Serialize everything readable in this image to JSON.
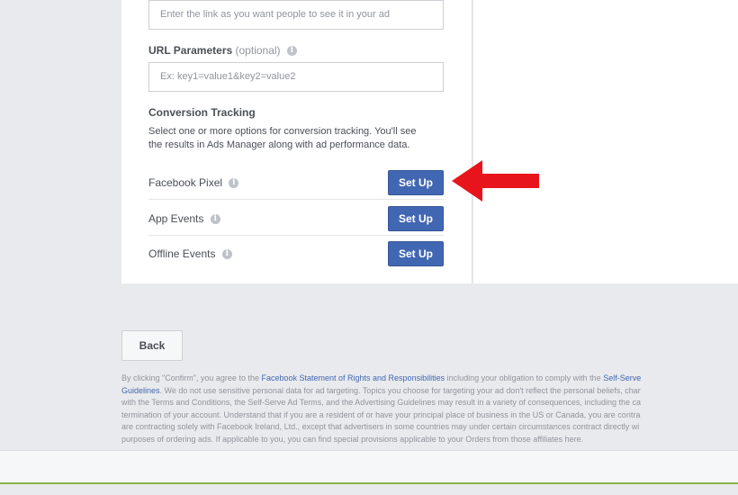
{
  "form": {
    "display_link_placeholder": "Enter the link as you want people to see it in your ad",
    "url_params_label": "URL Parameters",
    "url_params_optional": "(optional)",
    "url_params_placeholder": "Ex: key1=value1&key2=value2",
    "conversion_title": "Conversion Tracking",
    "conversion_desc_line1": "Select one or more options for conversion tracking. You'll see",
    "conversion_desc_line2": "the results in Ads Manager along with ad performance data.",
    "tracking_rows": [
      {
        "label": "Facebook Pixel",
        "button": "Set Up"
      },
      {
        "label": "App Events",
        "button": "Set Up"
      },
      {
        "label": "Offline Events",
        "button": "Set Up"
      }
    ]
  },
  "actions": {
    "back_label": "Back"
  },
  "legal": {
    "l1a": "By clicking \"Confirm\", you agree to the ",
    "l1b": "Facebook Statement of Rights and Responsibilities",
    "l1c": " including your obligation to comply with the ",
    "l1d": "Self-Serve",
    "l2a": "Guidelines",
    "l2b": ". We do not use sensitive personal data for ad targeting. Topics you choose for targeting your ad don't reflect the personal beliefs, char",
    "l3": "with the Terms and Conditions, the Self-Serve Ad Terms, and the Advertising Guidelines may result in a variety of consequences, including the ca",
    "l4": "termination of your account. Understand that if you are a resident of or have your principal place of business in the US or Canada, you are contra",
    "l5": "are contracting solely with Facebook Ireland, Ltd., except that advertisers in some countries may under certain circumstances contract directly wi",
    "l6": "purposes of ordering ads. If applicable to you, you can find special provisions applicable to your Orders from those affiliates here."
  },
  "colors": {
    "primary": "#4267b2",
    "arrow": "#e8141b",
    "footer_accent": "#8ab34a"
  },
  "icons": {
    "info": "info-icon",
    "arrow": "red-arrow-left"
  }
}
